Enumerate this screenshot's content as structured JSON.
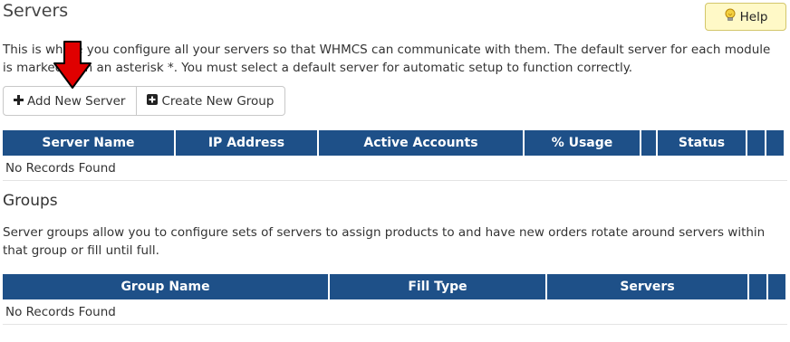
{
  "page": {
    "title": "Servers",
    "help_label": "Help",
    "description": "This is where you configure all your servers so that WHMCS can communicate with them. The default server for each module is marked with an asterisk *. You must select a default server for automatic setup to function correctly."
  },
  "toolbar": {
    "add_server_label": "Add New Server",
    "create_group_label": "Create New Group"
  },
  "servers_table": {
    "headers": [
      "Server Name",
      "IP Address",
      "Active Accounts",
      "% Usage",
      "",
      "Status",
      "",
      ""
    ],
    "empty_text": "No Records Found"
  },
  "groups": {
    "title": "Groups",
    "description": "Server groups allow you to configure sets of servers to assign products to and have new orders rotate around servers within that group or fill until full."
  },
  "groups_table": {
    "headers": [
      "Group Name",
      "Fill Type",
      "Servers",
      "",
      ""
    ],
    "empty_text": "No Records Found"
  },
  "colors": {
    "table_header_bg": "#1e5088",
    "help_button_bg": "#fff9c7",
    "annotation_arrow": "#e00000"
  },
  "icons": [
    "lightbulb-icon",
    "plus-icon",
    "plus-square-icon",
    "down-arrow-annotation"
  ]
}
